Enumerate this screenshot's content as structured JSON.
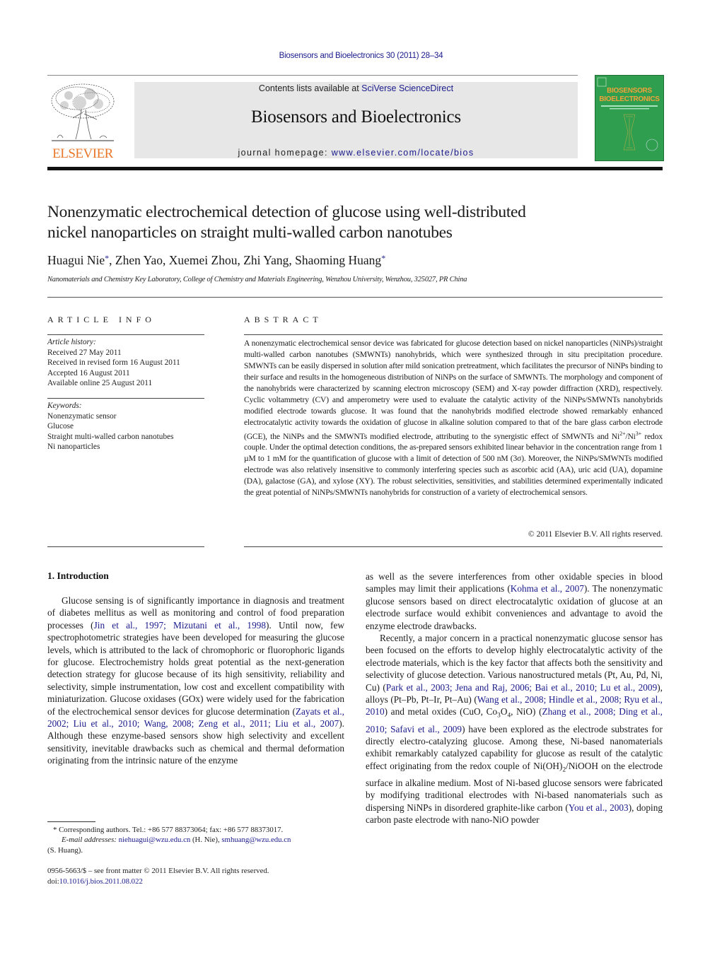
{
  "header": {
    "citation": "Biosensors and Bioelectronics 30 (2011) 28–34",
    "publisher_logo_text": "ELSEVIER",
    "contents_prefix": "Contents lists available at ",
    "contents_link": "SciVerse ScienceDirect",
    "journal_title": "Biosensors and Bioelectronics",
    "homepage_prefix": "journal homepage: ",
    "homepage_link": "www.elsevier.com/locate/bios",
    "cover_line1": "BIOSENSORS",
    "cover_line2": "BIOELECTRONICS"
  },
  "article": {
    "title_line1": "Nonenzymatic electrochemical detection of glucose using well-distributed",
    "title_line2": "nickel nanoparticles on straight multi-walled carbon nanotubes",
    "authors": [
      {
        "name": "Huagui Nie",
        "corresponding": true,
        "sep": ", "
      },
      {
        "name": "Zhen Yao",
        "corresponding": false,
        "sep": ", "
      },
      {
        "name": "Xuemei Zhou",
        "corresponding": false,
        "sep": ", "
      },
      {
        "name": "Zhi Yang",
        "corresponding": false,
        "sep": ", "
      },
      {
        "name": "Shaoming Huang",
        "corresponding": true,
        "sep": ""
      }
    ],
    "star": "*",
    "affiliation": "Nanomaterials and Chemistry Key Laboratory, College of Chemistry and Materials Engineering, Wenzhou University, Wenzhou, 325027, PR China"
  },
  "article_info": {
    "heading": "ARTICLE INFO",
    "history_label": "Article history:",
    "history": [
      "Received 27 May 2011",
      "Received in revised form 16 August 2011",
      "Accepted 16 August 2011",
      "Available online 25 August 2011"
    ],
    "keywords_label": "Keywords:",
    "keywords": [
      "Nonenzymatic sensor",
      "Glucose",
      "Straight multi-walled carbon nanotubes",
      "Ni nanoparticles"
    ]
  },
  "abstract": {
    "heading": "ABSTRACT",
    "part1": "A nonenzymatic electrochemical sensor device was fabricated for glucose detection based on nickel nanoparticles (NiNPs)/straight multi-walled carbon nanotubes (SMWNTs) nanohybrids, which were synthesized through in situ precipitation procedure. SMWNTs can be easily dispersed in solution after mild sonication pretreatment, which facilitates the precursor of NiNPs binding to their surface and results in the homogeneous distribution of NiNPs on the surface of SMWNTs. The morphology and component of the nanohybrids were characterized by scanning electron microscopy (SEM) and X-ray powder diffraction (XRD), respectively. Cyclic voltammetry (CV) and amperometry were used to evaluate the catalytic activity of the NiNPs/SMWNTs nanohybrids modified electrode towards glucose. It was found that the nanohybrids modified electrode showed remarkably enhanced electrocatalytic activity towards the oxidation of glucose in alkaline solution compared to that of the bare glass carbon electrode (GCE), the NiNPs and the SMWNTs modified electrode, attributing to the synergistic effect of SMWNTs and Ni",
    "sup1": "2+",
    "mid": "/Ni",
    "sup2": "3+",
    "part2": " redox couple. Under the optimal detection conditions, the as-prepared sensors exhibited linear behavior in the concentration range from 1 µM to 1 mM for the quantification of glucose with a limit of detection of 500 nM (3σ). Moreover, the NiNPs/SMWNTs modified electrode was also relatively insensitive to commonly interfering species such as ascorbic acid (AA), uric acid (UA), dopamine (DA), galactose (GA), and xylose (XY). The robust selectivities, sensitivities, and stabilities determined experimentally indicated the great potential of NiNPs/SMWNTs nanohybrids for construction of a variety of electrochemical sensors.",
    "copyright": "© 2011 Elsevier B.V. All rights reserved."
  },
  "introduction": {
    "heading": "1.  Introduction",
    "left_p1_a": "Glucose sensing is of significantly importance in diagnosis and treatment of diabetes mellitus as well as monitoring and control of food preparation processes (",
    "left_p1_ref1": "Jin et al., 1997; Mizutani et al., 1998",
    "left_p1_b": "). Until now, few spectrophotometric strategies have been developed for measuring the glucose levels, which is attributed to the lack of chromophoric or fluorophoric ligands for glucose. Electrochemistry holds great potential as the next-generation detection strategy for glucose because of its high sensitivity, reliability and selectivity, simple instrumentation, low cost and excellent compatibility with miniaturization. Glucose oxidases (GOx) were widely used for the fabrication of the electrochemical sensor devices for glucose determination (",
    "left_p1_ref2": "Zayats et al., 2002; Liu et al., 2010; Wang, 2008; Zeng et al., 2011; Liu et al., 2007",
    "left_p1_c": "). Although these enzyme-based sensors show high selectivity and excellent sensitivity, inevitable drawbacks such as chemical and thermal deformation originating from the intrinsic nature of the enzyme",
    "right_p1_a": "as well as the severe interferences from other oxidable species in blood samples may limit their applications (",
    "right_p1_ref1": "Kohma et al., 2007",
    "right_p1_b": "). The nonenzymatic glucose sensors based on direct electrocatalytic oxidation of glucose at an electrode surface would exhibit conveniences and advantage to avoid the enzyme electrode drawbacks.",
    "right_p2_a": "Recently, a major concern in a practical nonenzymatic glucose sensor has been focused on the efforts to develop highly electrocatalytic activity of the electrode materials, which is the key factor that affects both the sensitivity and selectivity of glucose detection. Various nanostructured metals (Pt, Au, Pd, Ni, Cu) (",
    "right_p2_ref1": "Park et al., 2003; Jena and Raj, 2006; Bai et al., 2010; Lu et al., 2009",
    "right_p2_b": "), alloys (Pt–Pb, Pt–Ir, Pt–Au) (",
    "right_p2_ref2": "Wang et al., 2008; Hindle et al., 2008; Ryu et al., 2010",
    "right_p2_c": ") and metal oxides (CuO, Co",
    "right_p2_sub1": "3",
    "right_p2_d": "O",
    "right_p2_sub2": "4",
    "right_p2_e": ", NiO) (",
    "right_p2_ref3": "Zhang et al., 2008; Ding et al., 2010; Safavi et al., 2009",
    "right_p2_f": ") have been explored as the electrode substrates for directly electro-catalyzing glucose. Among these, Ni-based nanomaterials exhibit remarkably catalyzed capability for glucose as result of the catalytic effect originating from the redox couple of Ni(OH)",
    "right_p2_sub3": "2",
    "right_p2_g": "/NiOOH on the electrode surface in alkaline medium. Most of Ni-based glucose sensors were fabricated by modifying traditional electrodes with Ni-based nanomaterials such as dispersing NiNPs in disordered graphite-like carbon (",
    "right_p2_ref4": "You et al., 2003",
    "right_p2_h": "), doping carbon paste electrode with nano-NiO powder"
  },
  "footnotes": {
    "star": "*",
    "corresponding": " Corresponding authors. Tel.: +86 577 88373064; fax: +86 577 88373017.",
    "email_label": "E-mail addresses:",
    "email1": "niehuagui@wzu.edu.cn",
    "email1_owner": " (H. Nie), ",
    "email2": "smhuang@wzu.edu.cn",
    "email2_owner": "(S. Huang).",
    "issn": "0956-5663/$ – see front matter © 2011 Elsevier B.V. All rights reserved.",
    "doi_prefix": "doi:",
    "doi": "10.1016/j.bios.2011.08.022"
  },
  "colors": {
    "link": "#1a1a8c",
    "elsevier_orange": "#e8772a",
    "cover_green": "#2f9e4e",
    "masthead_gray": "#e7e7e7"
  }
}
